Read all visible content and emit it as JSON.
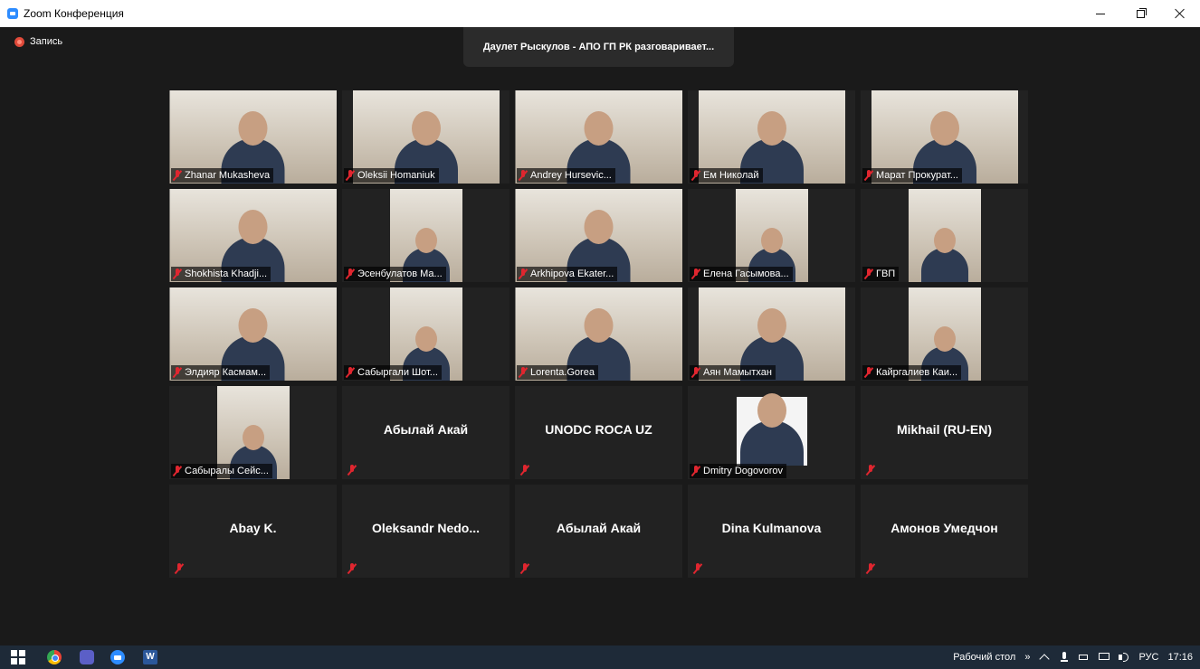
{
  "window": {
    "title": "Zoom Конференция"
  },
  "meeting": {
    "recording_label": "Запись",
    "active_speaker": "Даулет Рыскулов - АПО ГП РК разговаривает...",
    "participants": [
      {
        "name": "Zhanar Mukasheva",
        "video": "full"
      },
      {
        "name": "Oleksii Homaniuk",
        "video": "mid"
      },
      {
        "name": "Andrey Hursevic...",
        "video": "full"
      },
      {
        "name": "Ем Николай",
        "video": "mid"
      },
      {
        "name": "Марат Прокурат...",
        "video": "mid"
      },
      {
        "name": "Shokhista Khadji...",
        "video": "full"
      },
      {
        "name": "Эсенбулатов Ма...",
        "video": "narrow"
      },
      {
        "name": "Arkhipova Ekater...",
        "video": "full"
      },
      {
        "name": "Елена Гасымова...",
        "video": "narrow"
      },
      {
        "name": "ГВП",
        "video": "narrow"
      },
      {
        "name": "Элдияр Касмам...",
        "video": "full"
      },
      {
        "name": "Сабыргали Шот...",
        "video": "narrow"
      },
      {
        "name": "Lorenta.Gorea",
        "video": "full"
      },
      {
        "name": "Аян Мамытхан",
        "video": "mid"
      },
      {
        "name": "Кайргалиев Каи...",
        "video": "narrow"
      },
      {
        "name": "Сабыралы Сейс...",
        "video": "narrow"
      },
      {
        "name": "Абылай Акай",
        "video": "none"
      },
      {
        "name": "UNODC ROCA UZ",
        "video": "none"
      },
      {
        "name": "Dmitry Dogovorov",
        "video": "photo"
      },
      {
        "name": "Mikhail (RU-EN)",
        "video": "none"
      },
      {
        "name": "Abay K.",
        "video": "none"
      },
      {
        "name": "Oleksandr  Nedo...",
        "video": "none"
      },
      {
        "name": "Абылай Акай",
        "video": "none"
      },
      {
        "name": "Dina Kulmanova",
        "video": "none"
      },
      {
        "name": "Амонов Умедчон",
        "video": "none"
      }
    ]
  },
  "taskbar": {
    "desktop_label": "Рабочий стол",
    "chevron": "»",
    "language": "РУС",
    "time": "17:16",
    "word_letter": "W"
  },
  "colors": {
    "background": "#1a1a1a",
    "tile": "#222222",
    "muted_mic": "#e0262f",
    "taskbar": "#1e2a38"
  }
}
